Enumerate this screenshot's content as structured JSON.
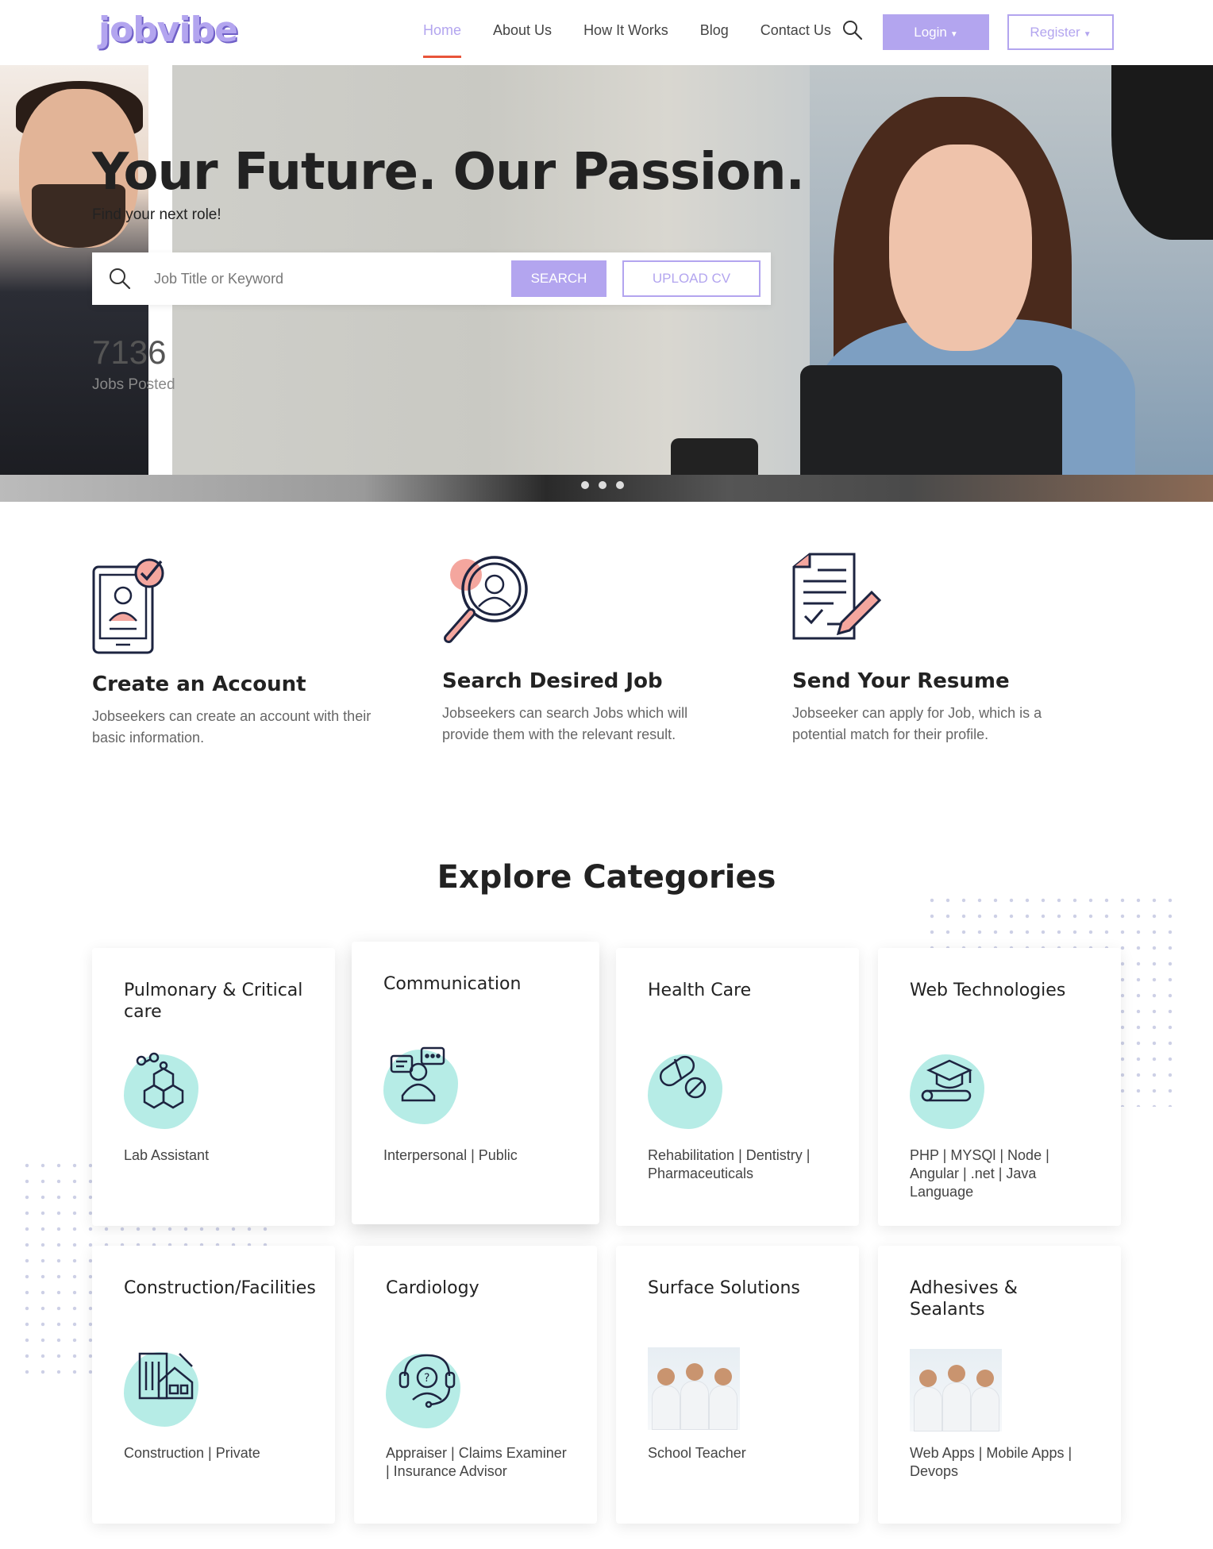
{
  "header": {
    "logo": "jobvibe",
    "nav": [
      "Home",
      "About Us",
      "How It Works",
      "Blog",
      "Contact Us"
    ],
    "active_nav": "Home",
    "login_label": "Login",
    "register_label": "Register",
    "accent": "#b3a5ef",
    "active_underline": "#e8543a"
  },
  "hero": {
    "title": "Your Future. Our Passion.",
    "subtitle": "Find your next role!",
    "search_placeholder": "Job Title or Keyword",
    "search_button": "SEARCH",
    "upload_button": "UPLOAD CV",
    "stat_number": "7136",
    "stat_label": "Jobs Posted",
    "slides": 3
  },
  "steps": [
    {
      "title": "Create an Account",
      "text": "Jobseekers can create an account with their basic information.",
      "icon": "account-phone-icon"
    },
    {
      "title": "Search Desired Job",
      "text": "Jobseekers can search Jobs which will provide them with the relevant result.",
      "icon": "magnifier-person-icon"
    },
    {
      "title": "Send Your Resume",
      "text": "Jobseeker can apply for Job, which is a potential match for their profile.",
      "icon": "resume-pen-icon"
    }
  ],
  "categories_section": {
    "title_plain": "Explore",
    "title_highlight": "Categories",
    "highlight_color": "#f4a69e",
    "blob_color": "#b6ece6"
  },
  "categories": [
    {
      "title": "Pulmonary & Critical care",
      "tags": "Lab Assistant",
      "icon": "molecule-icon"
    },
    {
      "title": "Communication",
      "tags": "Interpersonal | Public",
      "icon": "chat-person-icon"
    },
    {
      "title": "Health Care",
      "tags": "Rehabilitation | Dentistry | Pharmaceuticals",
      "icon": "pills-icon"
    },
    {
      "title": "Web Technologies",
      "tags": "PHP | MYSQl | Node | Angular | .net | Java Language",
      "icon": "graduation-cap-icon"
    },
    {
      "title": "Construction/Facilities",
      "tags": "Construction | Private",
      "icon": "building-icon"
    },
    {
      "title": "Cardiology",
      "tags": "Appraiser | Claims Examiner | Insurance Advisor",
      "icon": "headset-support-icon"
    },
    {
      "title": "Surface Solutions",
      "tags": "School Teacher",
      "icon": "doctors-photo-icon"
    },
    {
      "title": "Adhesives & Sealants",
      "tags": "Web Apps | Mobile Apps | Devops",
      "icon": "doctors-photo-icon"
    }
  ]
}
